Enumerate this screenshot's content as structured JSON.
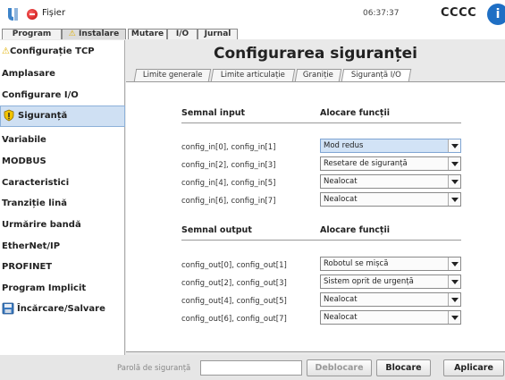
{
  "topbar": {
    "file_label": "Fișier",
    "time": "06:37:37",
    "robot_name": "CCCC",
    "info_glyph": "i"
  },
  "tabs": {
    "program": "Program",
    "instalare": "Instalare",
    "mutare": "Mutare",
    "io": "I/O",
    "jurnal": "Jurnal"
  },
  "sidebar": {
    "items": [
      {
        "label": "Configurație TCP",
        "icon": "warning-icon"
      },
      {
        "label": "Amplasare"
      },
      {
        "label": "Configurare I/O"
      },
      {
        "label": "Siguranță",
        "icon": "shield-warning-icon",
        "selected": true
      },
      {
        "label": "Variabile"
      },
      {
        "label": "MODBUS"
      },
      {
        "label": "Caracteristici"
      },
      {
        "label": "Tranziție lină"
      },
      {
        "label": "Urmărire bandă"
      },
      {
        "label": "EtherNet/IP"
      },
      {
        "label": "PROFINET"
      },
      {
        "label": "Program Implicit"
      },
      {
        "label": "Încărcare/Salvare",
        "icon": "save-icon"
      }
    ]
  },
  "main": {
    "title": "Configurarea siguranței",
    "subtabs": [
      "Limite generale",
      "Limite articulație",
      "Graniție",
      "Siguranță I/O"
    ],
    "active_subtab": "Siguranță I/O",
    "input_section": {
      "signal_header": "Semnal input",
      "function_header": "Alocare funcții",
      "rows": [
        {
          "signal": "config_in[0], config_in[1]",
          "value": "Mod redus"
        },
        {
          "signal": "config_in[2], config_in[3]",
          "value": "Resetare de siguranță"
        },
        {
          "signal": "config_in[4], config_in[5]",
          "value": "Nealocat"
        },
        {
          "signal": "config_in[6], config_in[7]",
          "value": "Nealocat"
        }
      ]
    },
    "output_section": {
      "signal_header": "Semnal output",
      "function_header": "Alocare funcții",
      "rows": [
        {
          "signal": "config_out[0], config_out[1]",
          "value": "Robotul se mișcă"
        },
        {
          "signal": "config_out[2], config_out[3]",
          "value": "Sistem oprit de urgență"
        },
        {
          "signal": "config_out[4], config_out[5]",
          "value": "Nealocat"
        },
        {
          "signal": "config_out[6], config_out[7]",
          "value": "Nealocat"
        }
      ]
    }
  },
  "bottom": {
    "password_label": "Parolă de siguranță",
    "password_value": "",
    "unlock_label": "Deblocare",
    "lock_label": "Blocare",
    "apply_label": "Aplicare"
  },
  "colors": {
    "selected_bg": "#cfe0f3",
    "highlight_select": "#d2e3f6",
    "accent_blue": "#1f6fc4",
    "warning_yellow": "#e0b000"
  }
}
